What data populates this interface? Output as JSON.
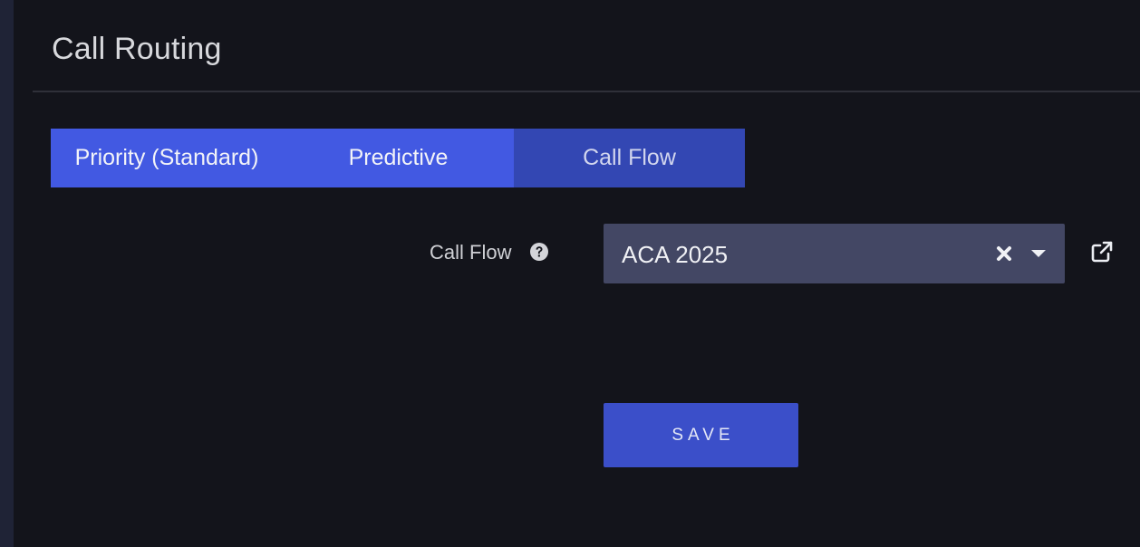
{
  "page": {
    "title": "Call Routing"
  },
  "tabs": [
    {
      "label": "Priority (Standard)"
    },
    {
      "label": "Predictive"
    },
    {
      "label": "Call Flow"
    }
  ],
  "active_tab": "Call Flow",
  "form": {
    "call_flow": {
      "label": "Call Flow",
      "value": "ACA 2025"
    },
    "save_label": "SAVE"
  },
  "icons": {
    "help": "question-circle-icon",
    "clear": "close-icon",
    "dropdown": "chevron-down-icon",
    "external": "external-link-icon"
  },
  "colors": {
    "background": "#13141b",
    "tab_bar": "#4259e2",
    "tab_active": "#3347b3",
    "select_bg": "#434764",
    "save_button": "#3b4fc9"
  }
}
